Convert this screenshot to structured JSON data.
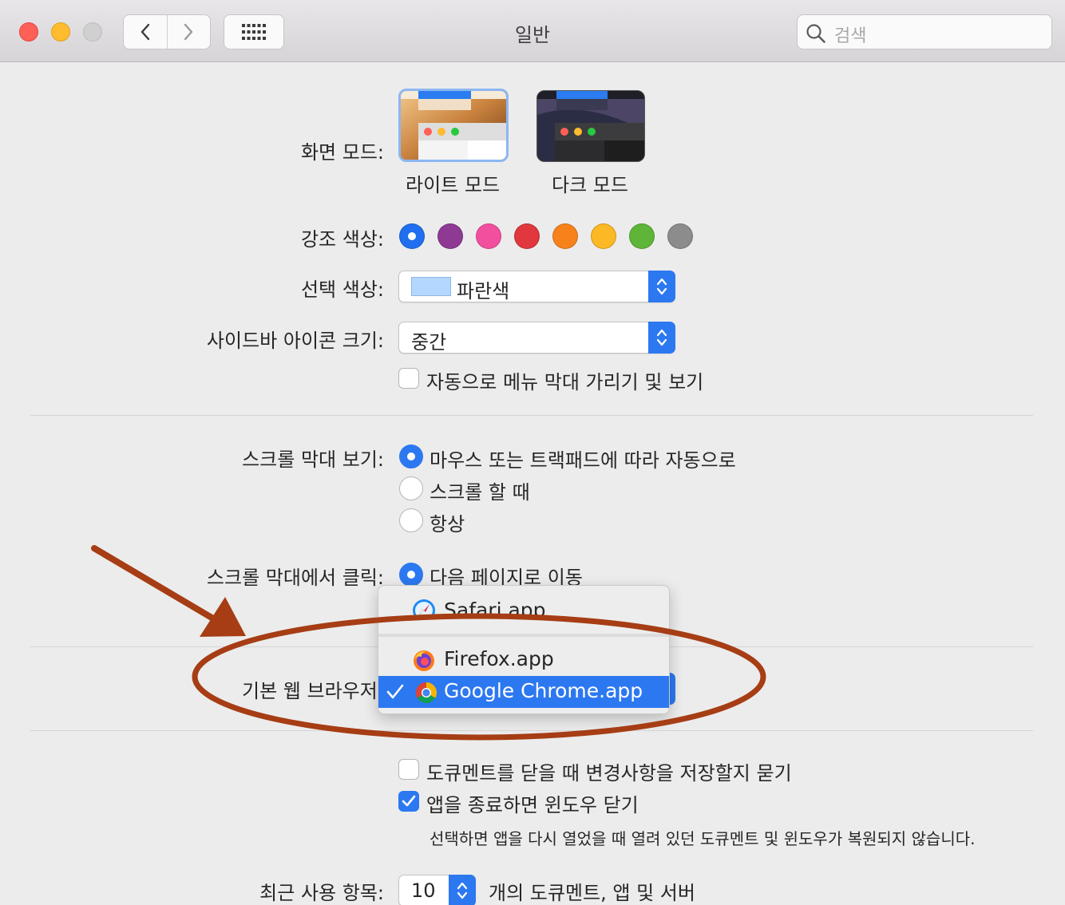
{
  "window": {
    "title": "일반",
    "search_placeholder": "검색"
  },
  "appearance": {
    "label": "화면 모드:",
    "options": [
      {
        "label": "라이트 모드",
        "selected": true
      },
      {
        "label": "다크 모드",
        "selected": false
      }
    ]
  },
  "accent": {
    "label": "강조 색상:",
    "colors": [
      "#1f6ff0",
      "#8e3a95",
      "#f34f9f",
      "#e0383e",
      "#f7821b",
      "#fcb825",
      "#5eb537",
      "#8c8c8c"
    ],
    "selected_index": 0
  },
  "highlight": {
    "label": "선택 색상:",
    "value": "파란색",
    "swatch_color": "#b3d7ff"
  },
  "sidebar_icon_size": {
    "label": "사이드바 아이콘 크기:",
    "value": "중간"
  },
  "auto_hide_menu": {
    "label": "자동으로 메뉴 막대 가리기 및 보기",
    "checked": false
  },
  "show_scroll_bars": {
    "label": "스크롤 막대 보기:",
    "options": [
      {
        "label": "마우스 또는 트랙패드에 따라 자동으로",
        "selected": true
      },
      {
        "label": "스크롤 할 때",
        "selected": false
      },
      {
        "label": "항상",
        "selected": false
      }
    ]
  },
  "click_scroll_bar": {
    "label": "스크롤 막대에서 클릭:",
    "options": [
      {
        "label": "다음 페이지로 이동",
        "selected": true
      }
    ]
  },
  "default_browser": {
    "label": "기본 웹 브라우저",
    "menu_items": [
      {
        "label": "Safari.app",
        "icon": "safari-icon",
        "selected": false
      },
      {
        "label": "Firefox.app",
        "icon": "firefox-icon",
        "selected": false
      },
      {
        "label": "Google Chrome.app",
        "icon": "chrome-icon",
        "selected": true
      }
    ]
  },
  "ask_keep_changes": {
    "label": "도큐멘트를 닫을 때 변경사항을 저장할지 묻기",
    "checked": false
  },
  "close_windows": {
    "label": "앱을 종료하면 윈도우 닫기",
    "checked": true,
    "note": "선택하면 앱을 다시 열었을 때 열려 있던 도큐멘트 및 윈도우가 복원되지 않습니다."
  },
  "recent_items": {
    "label": "최근 사용 항목:",
    "value": "10",
    "suffix": "개의 도큐멘트, 앱 및 서버"
  },
  "annotation": {
    "color": "#a63d14"
  }
}
